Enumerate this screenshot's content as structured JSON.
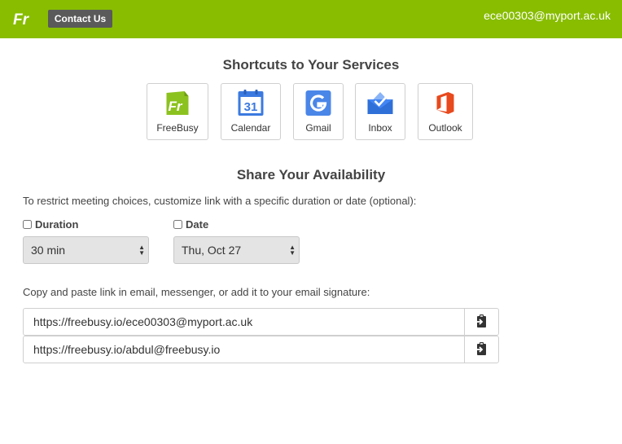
{
  "header": {
    "logo_icon": "freebusy-logo-icon",
    "contact_label": "Contact Us",
    "user_email": "ece00303@myport.ac.uk"
  },
  "shortcuts": {
    "title": "Shortcuts to Your Services",
    "items": [
      {
        "label": "FreeBusy",
        "icon": "freebusy-icon"
      },
      {
        "label": "Calendar",
        "icon": "google-calendar-icon"
      },
      {
        "label": "Gmail",
        "icon": "google-icon"
      },
      {
        "label": "Inbox",
        "icon": "inbox-icon"
      },
      {
        "label": "Outlook",
        "icon": "office-icon"
      }
    ]
  },
  "availability": {
    "title": "Share Your Availability",
    "instruction": "To restrict meeting choices, customize link with a specific duration or date (optional):",
    "duration": {
      "label": "Duration",
      "checked": false,
      "value": "30 min"
    },
    "date": {
      "label": "Date",
      "checked": false,
      "value": "Thu, Oct 27"
    },
    "calendar_day": "31",
    "copy_instruction": "Copy and paste link in email, messenger, or add it to your email signature:",
    "links": [
      "https://freebusy.io/ece00303@myport.ac.uk",
      "https://freebusy.io/abdul@freebusy.io"
    ]
  },
  "colors": {
    "header_bg": "#88bd00",
    "contact_bg": "#5a5a5a",
    "freebusy_green": "#8cc21f",
    "calendar_blue": "#3b7ae0",
    "inbox_blue": "#4285f4",
    "outlook_orange": "#e8491d"
  }
}
